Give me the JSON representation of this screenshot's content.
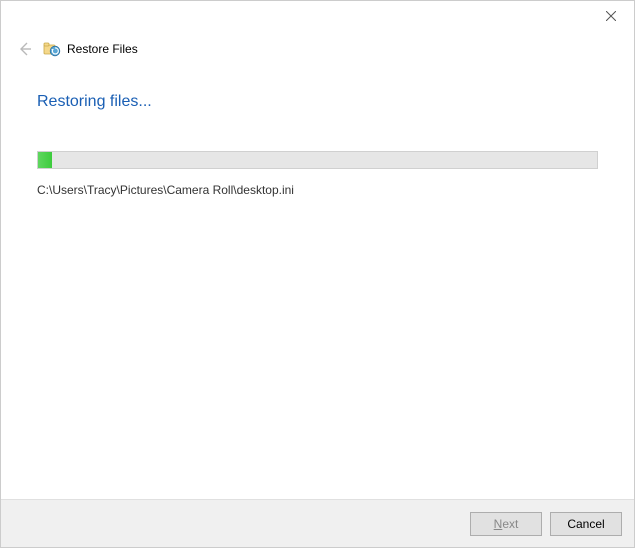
{
  "titlebar": {
    "app_title": "Restore Files"
  },
  "main": {
    "heading": "Restoring files...",
    "progress_percent": 2.5,
    "current_file": "C:\\Users\\Tracy\\Pictures\\Camera Roll\\desktop.ini"
  },
  "footer": {
    "next_label_prefix": "",
    "next_label_underlined": "N",
    "next_label_suffix": "ext",
    "cancel_label": "Cancel"
  },
  "icons": {
    "close": "close-icon",
    "back": "back-arrow-icon",
    "app": "restore-files-icon"
  }
}
